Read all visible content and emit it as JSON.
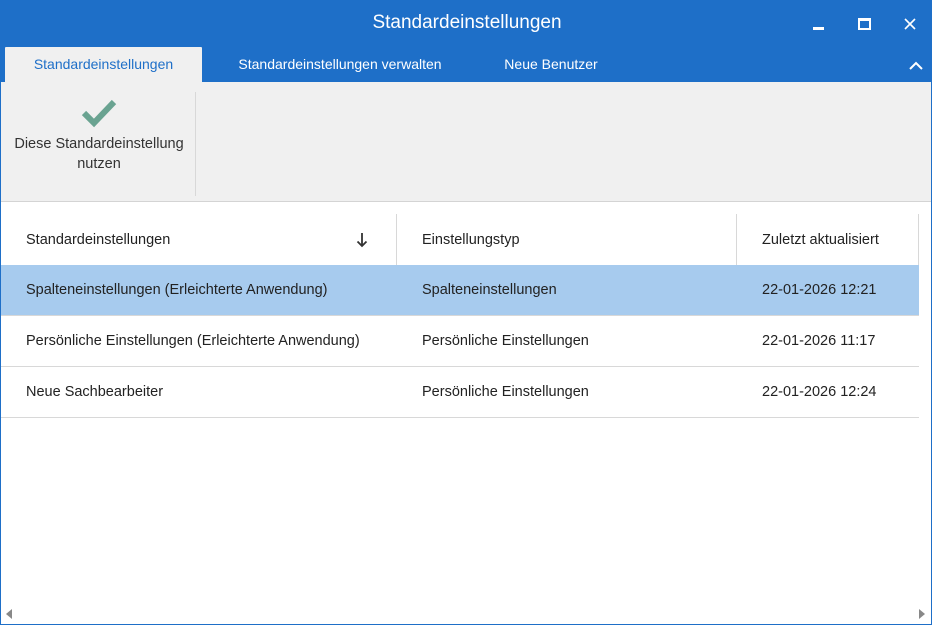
{
  "window": {
    "title": "Standardeinstellungen",
    "accent_color": "#1e6fc8",
    "selection_color": "#a7cbee"
  },
  "tabs": [
    {
      "label": "Standardeinstellungen",
      "active": true
    },
    {
      "label": "Standardeinstellungen verwalten",
      "active": false
    },
    {
      "label": "Neue Benutzer",
      "active": false
    }
  ],
  "ribbon": {
    "use_button": {
      "icon": "checkmark-icon",
      "line1": "Diese Standardeinstellung",
      "line2": "nutzen",
      "icon_color": "#6aa391"
    }
  },
  "grid": {
    "columns": [
      {
        "label": "Standardeinstellungen",
        "sort": "descending"
      },
      {
        "label": "Einstellungstyp"
      },
      {
        "label": "Zuletzt aktualisiert"
      }
    ],
    "rows": [
      {
        "name": "Spalteneinstellungen (Erleichterte Anwendung)",
        "type": "Spalteneinstellungen",
        "updated": "22-01-2026 12:21",
        "selected": true
      },
      {
        "name": "Persönliche Einstellungen (Erleichterte Anwendung)",
        "type": "Persönliche Einstellungen",
        "updated": "22-01-2026 11:17",
        "selected": false
      },
      {
        "name": "Neue Sachbearbeiter",
        "type": "Persönliche Einstellungen",
        "updated": "22-01-2026 12:24",
        "selected": false
      }
    ]
  }
}
